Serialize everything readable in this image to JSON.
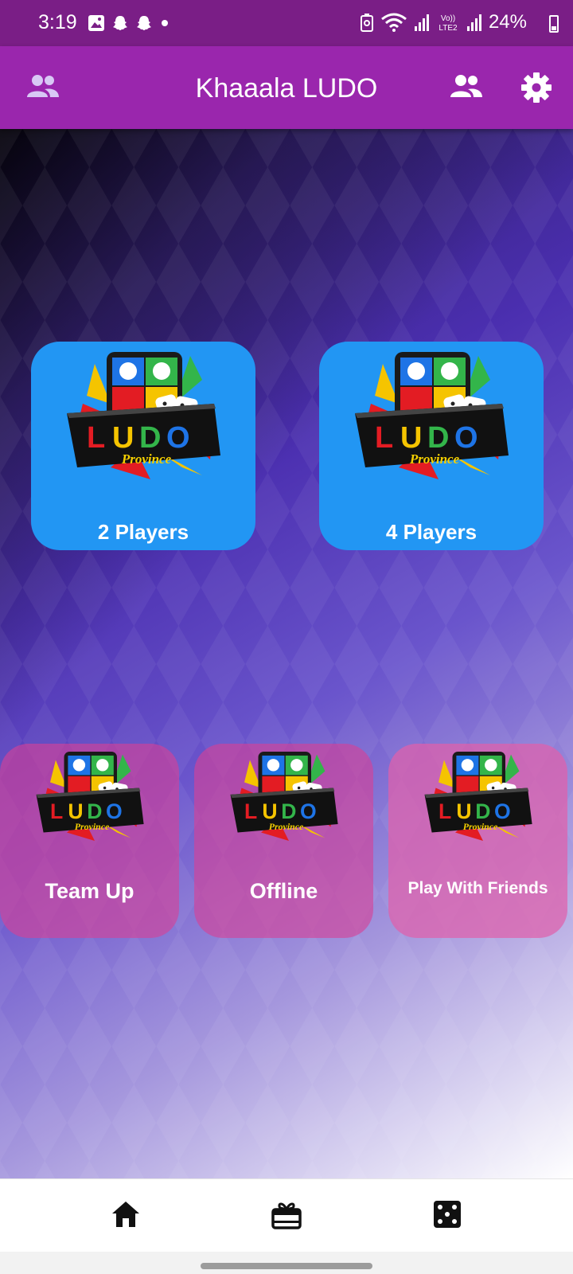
{
  "status_bar": {
    "time": "3:19",
    "left_icons": [
      "gallery-icon",
      "snapchat-icon",
      "snapchat-icon",
      "dot-icon"
    ],
    "network_label_top": "Vo))",
    "network_label_bottom": "LTE2",
    "battery": "24%"
  },
  "app_bar": {
    "title": "Khaaala LUDO",
    "left_icon": "people-icon",
    "right_icons": [
      "people-icon",
      "gear-icon"
    ]
  },
  "logo": {
    "word": [
      "L",
      "U",
      "D",
      "O"
    ],
    "word_colors": [
      "#e31c23",
      "#f5c400",
      "#33b54a",
      "#1e74e6"
    ],
    "tagline": "Province"
  },
  "modes": {
    "two_players": "2 Players",
    "four_players": "4 Players",
    "team_up": "Team Up",
    "offline": "Offline",
    "play_with_friends": "Play With Friends"
  },
  "colors": {
    "status_bar": "#7a1e86",
    "app_bar": "#9a26ad",
    "card_blue": "#2296f3",
    "card_pink": "#d74096"
  },
  "bottom_nav": [
    "home-icon",
    "gift-icon",
    "dice-icon"
  ]
}
